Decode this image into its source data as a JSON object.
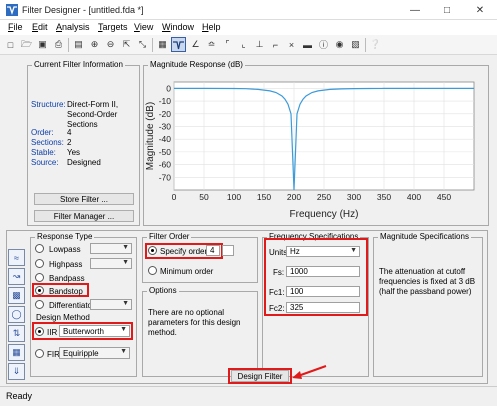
{
  "window": {
    "title": "Filter Designer - [untitled.fda *]"
  },
  "menu": [
    "File",
    "Edit",
    "Analysis",
    "Targets",
    "View",
    "Window",
    "Help"
  ],
  "toolbar": {
    "icons": [
      "new-icon",
      "open-icon",
      "save-icon",
      "print-icon",
      "print-preview-icon",
      "zoom-in-icon",
      "zoom-out-icon",
      "zoom-fit-icon",
      "full-view-icon",
      "pan-icon",
      "legend-icon",
      "magnitude-icon",
      "phase-icon",
      "mag-phase-icon",
      "group-delay-icon",
      "phase-delay-icon",
      "impulse-icon",
      "step-icon",
      "pole-zero-icon",
      "coefficients-icon",
      "info-icon",
      "cost-icon",
      "help-icon"
    ]
  },
  "current_filter_info": {
    "title": "Current Filter Information",
    "rows": [
      {
        "label": "Structure:",
        "value": "Direct-Form II, Second-Order Sections"
      },
      {
        "label": "Order:",
        "value": "4"
      },
      {
        "label": "Sections:",
        "value": "2"
      },
      {
        "label": "Stable:",
        "value": "Yes"
      },
      {
        "label": "Source:",
        "value": "Designed"
      }
    ],
    "store_button": "Store Filter ...",
    "manager_button": "Filter Manager ..."
  },
  "magnitude_panel": {
    "title": "Magnitude Response (dB)"
  },
  "chart_data": {
    "type": "line",
    "xlabel": "Frequency (Hz)",
    "ylabel": "Magnitude (dB)",
    "xlim": [
      0,
      500
    ],
    "ylim": [
      -80,
      5
    ],
    "xticks": [
      0,
      50,
      100,
      150,
      200,
      250,
      300,
      350,
      400,
      450
    ],
    "yticks": [
      0,
      -10,
      -20,
      -30,
      -40,
      -50,
      -60,
      -70
    ],
    "series": [
      {
        "x": [
          0,
          50,
          100,
          120,
          140,
          160,
          170,
          180,
          185,
          190,
          195,
          200,
          205,
          210,
          215,
          220,
          230,
          240,
          260,
          280,
          300,
          325,
          350,
          400,
          450,
          500
        ],
        "y": [
          0,
          -0.01,
          -0.1,
          -0.3,
          -0.8,
          -2,
          -3.3,
          -6,
          -8.5,
          -12.5,
          -20,
          -80,
          -20,
          -12.5,
          -8.5,
          -6,
          -3.3,
          -2,
          -0.8,
          -0.4,
          -0.2,
          -0.1,
          -0.05,
          -0.01,
          0,
          0
        ]
      }
    ],
    "color": "#3b9ad9",
    "grid": true
  },
  "response_type": {
    "title": "Response Type",
    "options": [
      {
        "label": "Lowpass",
        "checked": false,
        "select": "",
        "select_enabled": false
      },
      {
        "label": "Highpass",
        "checked": false,
        "select": "",
        "select_enabled": false
      },
      {
        "label": "Bandpass",
        "checked": false,
        "select": "",
        "select_enabled": false
      },
      {
        "label": "Bandstop",
        "checked": true,
        "select": "",
        "select_enabled": false
      },
      {
        "label": "Differentiator",
        "checked": false,
        "select": "",
        "select_enabled": false
      }
    ]
  },
  "design_method": {
    "title": "Design Method",
    "iir_label": "IIR",
    "iir_value": "Butterworth",
    "fir_label": "FIR",
    "fir_value": "Equiripple"
  },
  "filter_order": {
    "title": "Filter Order",
    "specify_label": "Specify order:",
    "specify_value": "4",
    "minimum_label": "Minimum order"
  },
  "options": {
    "title": "Options",
    "text": "There are no optional parameters for this design method."
  },
  "frequency_specs": {
    "title": "Frequency Specifications",
    "units_label": "Units:",
    "units_value": "Hz",
    "fs_label": "Fs:",
    "fs_value": "1000",
    "fc1_label": "Fc1:",
    "fc1_value": "100",
    "fc2_label": "Fc2:",
    "fc2_value": "325"
  },
  "magnitude_specs": {
    "title": "Magnitude Specifications",
    "text": "The attenuation at cutoff frequencies is fixed at 3 dB (half the passband power)"
  },
  "design_button": "Design Filter",
  "status": "Ready"
}
